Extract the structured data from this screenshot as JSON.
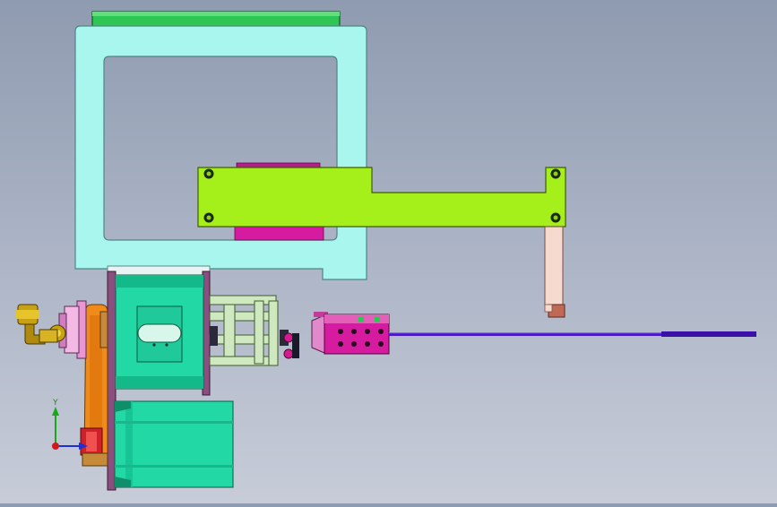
{
  "viewport": {
    "background_top": "#8f9bb0",
    "background_bottom": "#c7ccd8"
  },
  "colors": {
    "frame_fill": "#a8f6ee",
    "frame_stroke": "#5c8a88",
    "top_bar": "#2fc653",
    "bracket": "#a5ef1a",
    "bracket_stroke": "#4a6b0a",
    "magenta_block": "#d61ba0",
    "motor_body": "#22d9a6",
    "motor_dark": "#0f8e6a",
    "purple_plate": "#8a4f7e",
    "orange_belt": "#f08a1a",
    "brass_fitting": "#c9a213",
    "pink_part": "#e996d6",
    "needle": "#4a18c8",
    "peach_post": "#f6d9cf",
    "red_pulley": "#d0202a"
  },
  "triad": {
    "y_label": "Y",
    "y_axis_color": "#1aa81a",
    "x_axis_color": "#2030d0",
    "origin_color": "#d01a1a"
  }
}
